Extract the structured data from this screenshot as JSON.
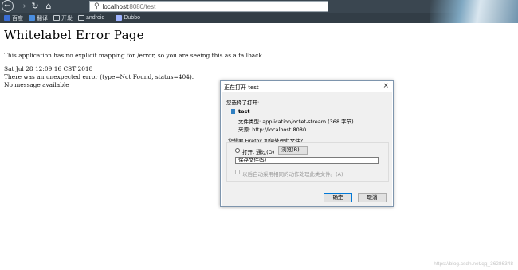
{
  "browser": {
    "url_host": "localhost",
    "url_path": ":8080/test",
    "bookmarks": [
      "百度",
      "翻译",
      "开发",
      "android",
      "Dubbo"
    ]
  },
  "page": {
    "title": "Whitelabel Error Page",
    "line1": "This application has no explicit mapping for /error, so you are seeing this as a fallback.",
    "line2": "Sat Jul 28 12:09:16 CST 2018",
    "line3": "There was an unexpected error (type=Not Found, status=404).",
    "line4": "No message available"
  },
  "dialog": {
    "title": "正在打开 test",
    "close": "×",
    "opening_label": "您选择了打开:",
    "file_name": "test",
    "file_type": "文件类型:   application/octet-stream (368 字节)",
    "source": "来源:   http://localhost:8080",
    "question": "您想要 Firefox 如何处理此文件?",
    "open_with": "打开, 通过(O)",
    "browse": "浏览(B)...",
    "save_file": "保存文件(S)",
    "auto_remember": "以后自动采用相同的动作处理此类文件。(A)",
    "ok": "确定",
    "cancel": "取消"
  },
  "watermark": "https://blog.csdn.net/qq_36286348",
  "colors": {
    "toolbar": "#3a4650",
    "bookmarks_bar": "#323d46",
    "dialog_border": "#7e95ad",
    "primary_button_border": "#0078d7"
  }
}
